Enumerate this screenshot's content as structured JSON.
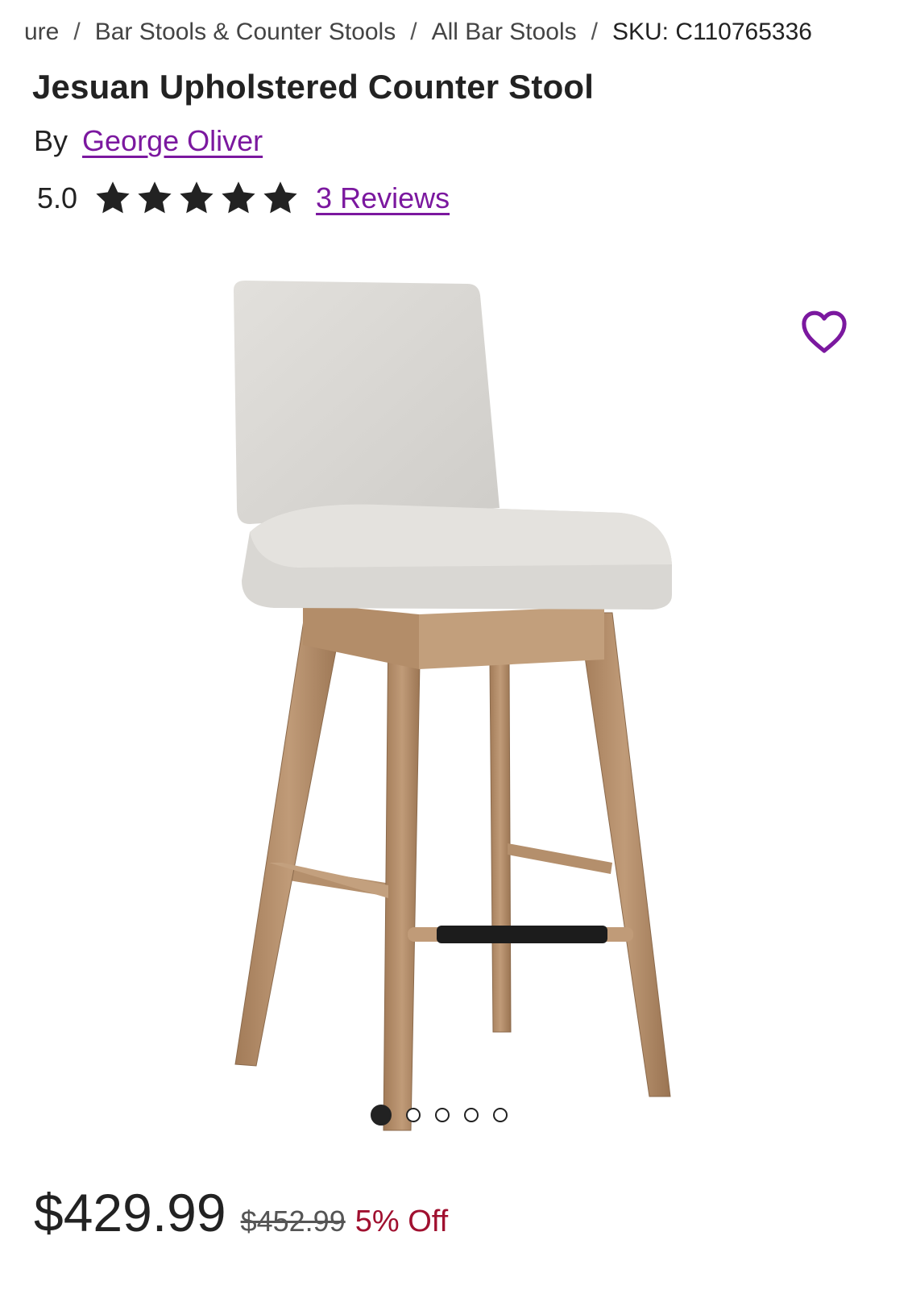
{
  "breadcrumb": {
    "items": [
      "ure",
      "Bar Stools & Counter Stools",
      "All Bar Stools",
      "SKU: C110765336"
    ],
    "separator": "/"
  },
  "product": {
    "title": "Jesuan Upholstered Counter Stool",
    "by_label": "By",
    "brand": "George Oliver",
    "rating_value": "5.0",
    "stars": 5,
    "reviews_link": "3 Reviews"
  },
  "gallery": {
    "image_count": 5,
    "active_index": 0
  },
  "pricing": {
    "sale_price": "$429.99",
    "original_price": "$452.99",
    "discount": "5% Off"
  },
  "colors": {
    "link_purple": "#7b189f",
    "discount_red": "#a0102f",
    "star": "#222222"
  },
  "icons": {
    "wishlist": "heart-outline-icon",
    "rating": "star-icon"
  }
}
